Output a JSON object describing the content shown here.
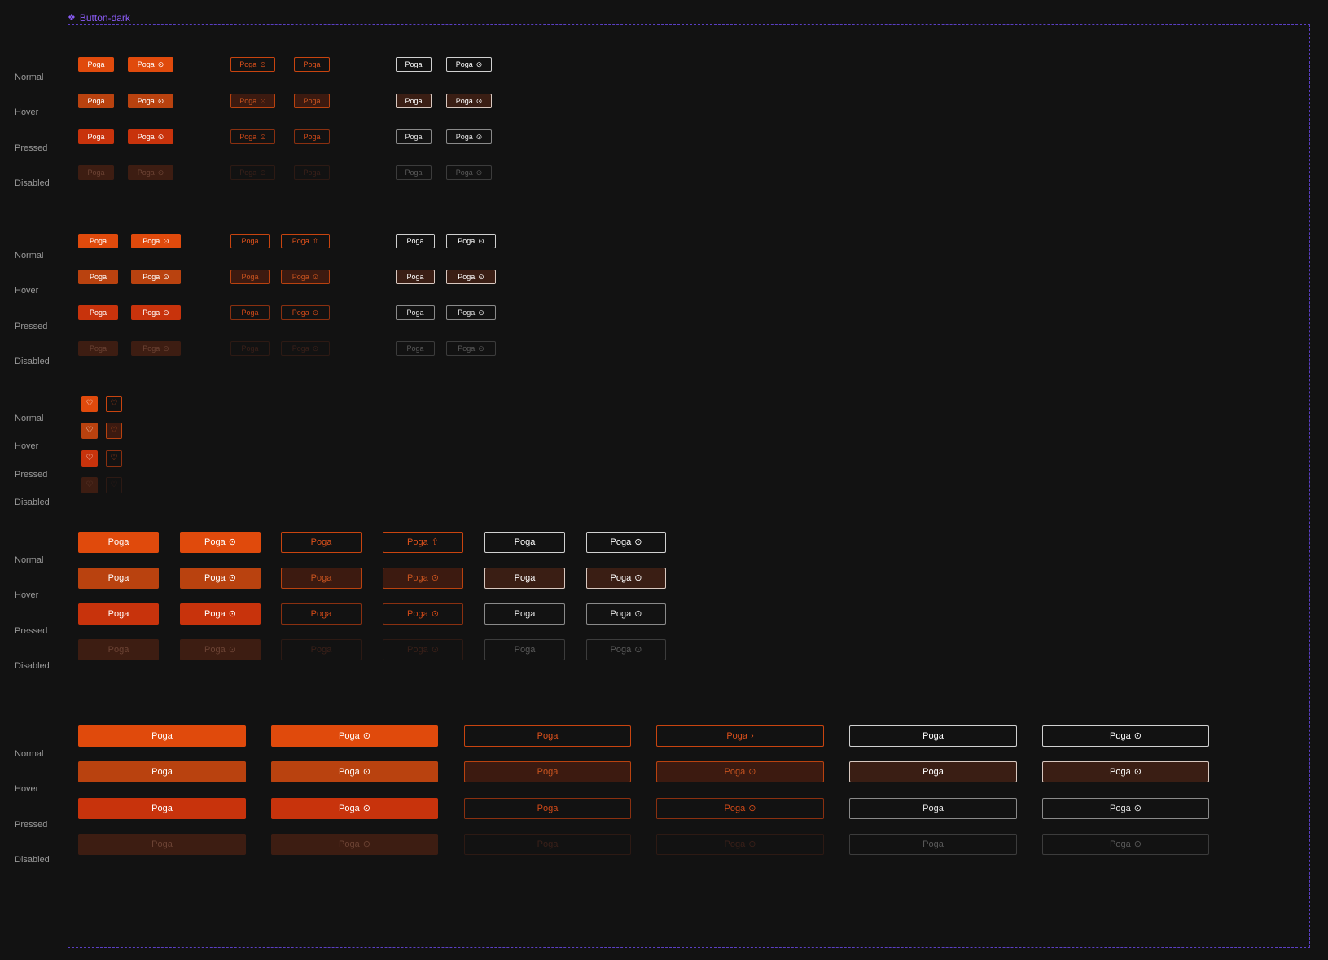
{
  "frame": {
    "title": "Button-dark",
    "icon": "component-diamond-icon"
  },
  "states": [
    "Normal",
    "Hover",
    "Pressed",
    "Disabled"
  ],
  "button_label": "Poga",
  "icons": {
    "circle_arrow": "⊙",
    "share": "⇧",
    "chevron": "›",
    "heart": "♡"
  },
  "colors": {
    "accent": "#e04a0c",
    "accent_hover": "#b9420f",
    "accent_pressed": "#c8330c",
    "accent_disabled": "#3d1d12",
    "frame_border": "#5b3fc4",
    "frame_title": "#8b5cf6",
    "background": "#121212"
  }
}
